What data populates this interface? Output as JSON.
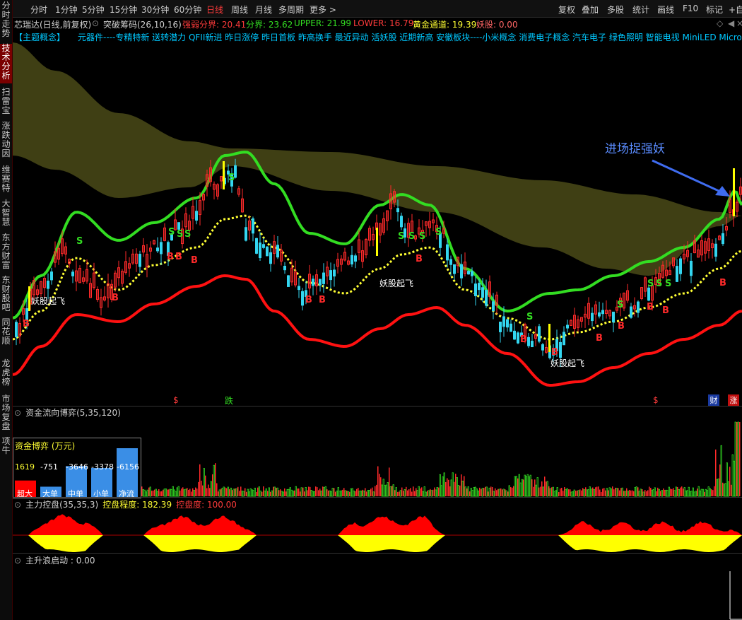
{
  "sidebar": {
    "items": [
      {
        "label": "分时走势",
        "active": false
      },
      {
        "label": "技术分析",
        "active": true
      },
      {
        "label": "扫雷宝",
        "active": false
      },
      {
        "label": "涨跌动因",
        "active": false
      },
      {
        "label": "维赛特",
        "active": false
      },
      {
        "label": "大智慧",
        "active": false
      },
      {
        "label": "东方财富",
        "active": false
      },
      {
        "label": "东财股吧",
        "active": false
      },
      {
        "label": "同花顺",
        "active": false
      },
      {
        "label": "龙虎榜",
        "active": false
      },
      {
        "label": "市场复盘",
        "active": false
      },
      {
        "label": "项牛",
        "active": false
      }
    ]
  },
  "toolbar": {
    "left": [
      "分时",
      "1分钟",
      "5分钟",
      "15分钟",
      "30分钟",
      "60分钟",
      "日线",
      "周线",
      "月线",
      "多周期",
      "更多 >"
    ],
    "active_index": 6,
    "right": [
      "复权",
      "叠加",
      "多股",
      "统计",
      "画线",
      "F10",
      "标记",
      "+自"
    ]
  },
  "info": {
    "stock": "芯瑞达(日线,前复权)",
    "indicator": "突破筹码(26,10,16)",
    "weak": "强弱分界: 20.41",
    "split": "分界: 23.62",
    "upper": "UPPER: 21.99",
    "lower": "LOWER: 16.79",
    "gold": "黄金通道: 19.39",
    "yao": "妖股: 0.00"
  },
  "concepts": {
    "header": "【主题概念】",
    "text": "元器件----专精特新 送转潜力 QFII新进 昨日涨停 昨日首板 昨高换手 最近异动 活妖股 近期新高 安徽板块----小米概念 消费电子概念 汽车电子 绿色照明 智能电视 MiniLED MicroLED"
  },
  "annotations": {
    "callout": "进场捉强妖",
    "yao_label": "妖股起飞",
    "buy": "B",
    "sell": "S",
    "bottom_flags": [
      "$",
      "跌",
      "$",
      "财",
      "涨"
    ]
  },
  "panel_flow": {
    "title": "资金流向博弈(5,35,120)",
    "box_title": "资金博弈 (万元)",
    "bars": [
      {
        "label": "超大",
        "value": 1619,
        "color": "#ff0000"
      },
      {
        "label": "大单",
        "value": -751,
        "color": "#3a8ee6"
      },
      {
        "label": "中单",
        "value": -3646,
        "color": "#3a8ee6"
      },
      {
        "label": "小单",
        "value": -3378,
        "color": "#3a8ee6"
      },
      {
        "label": "净流",
        "value": -6156,
        "color": "#3a8ee6"
      }
    ],
    "bar_texts": [
      "1619",
      "-751",
      "-3646",
      "-3378",
      "-6156"
    ]
  },
  "panel_control": {
    "title": "主力控盘(35,35,3)",
    "degree": "控盘程度: 182.39",
    "level": "控盘度: 100.00"
  },
  "panel_wave": {
    "title": "主升浪启动 : 0.00"
  },
  "colors": {
    "upper_band": "#33dd22",
    "mid_line": "#ffff33",
    "lower_band": "#ff1111",
    "cloud": "#4a4a18",
    "candle_up": "#ff2a2a",
    "candle_down": "#33d6f0",
    "active_tab": "#ff3b3b"
  }
}
